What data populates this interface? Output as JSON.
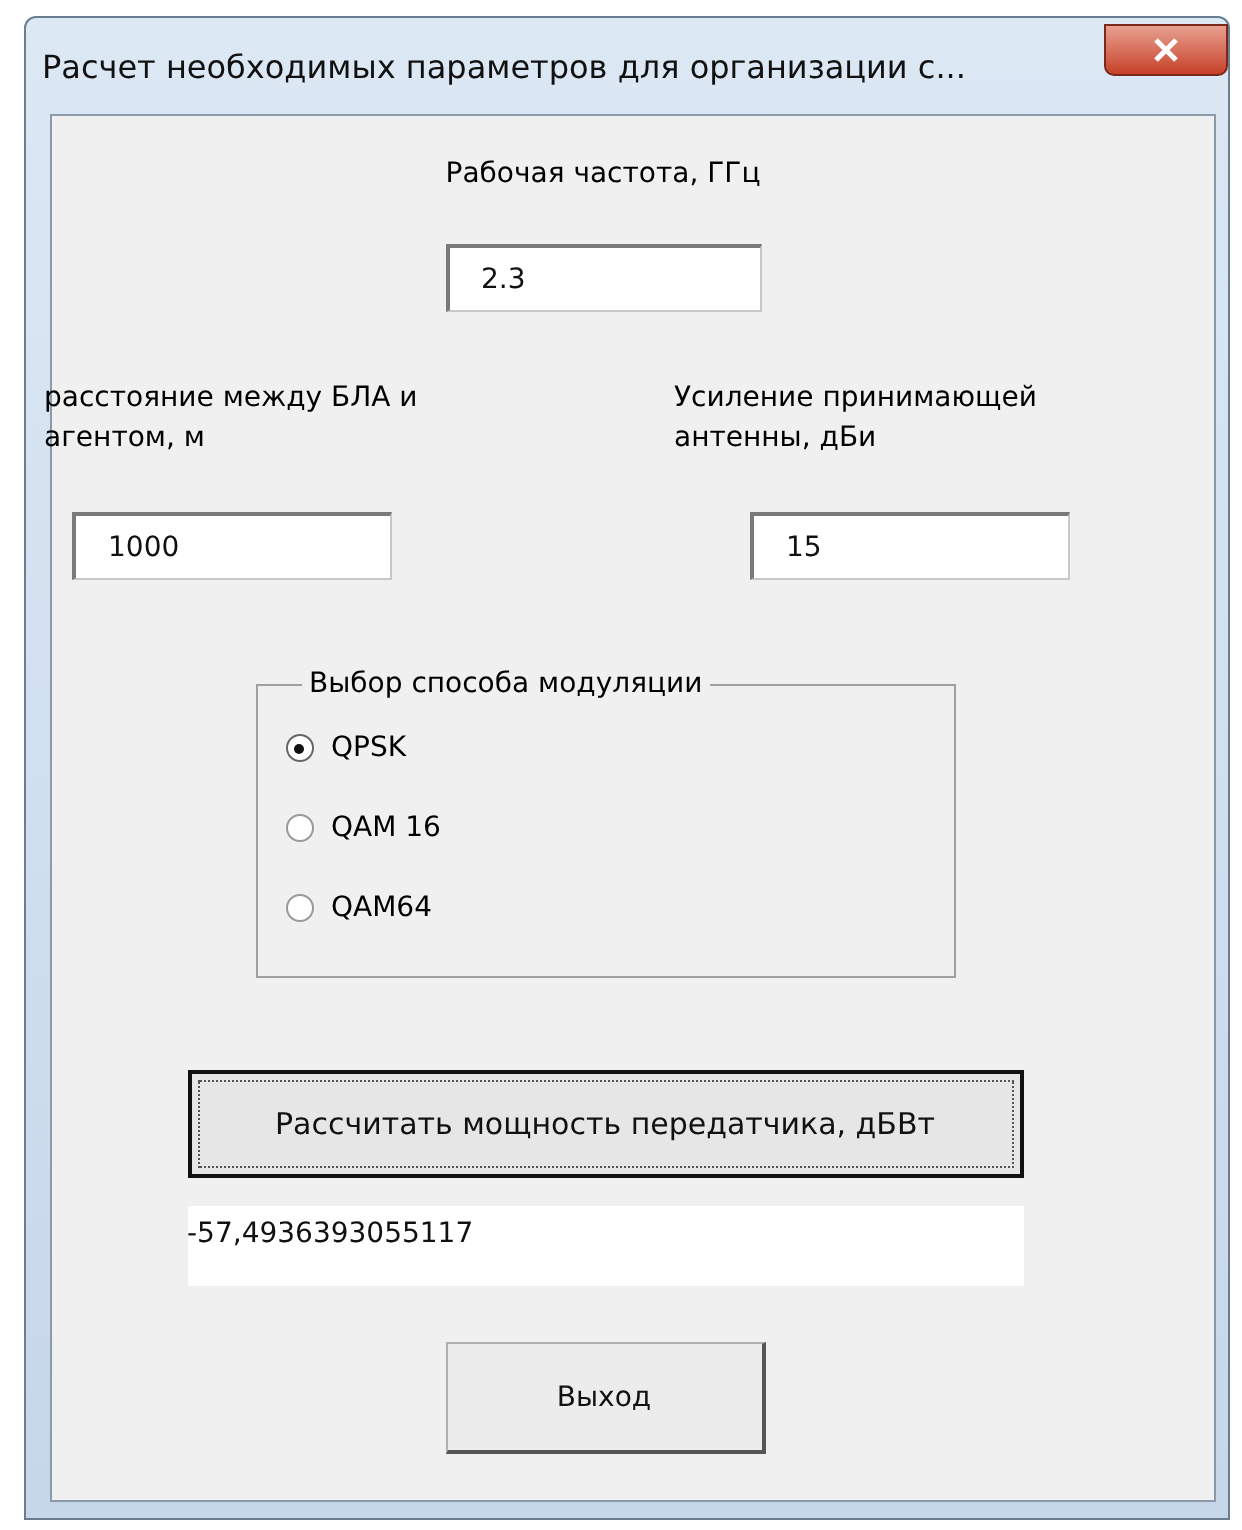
{
  "window": {
    "title": "Расчет необходимых параметров для организации с..."
  },
  "frequency": {
    "label": "Рабочая частота, ГГц",
    "value": "2.3"
  },
  "distance": {
    "label": "расстояние между БЛА и агентом, м",
    "value": "1000"
  },
  "gain": {
    "label": "Усиление принимающей антенны, дБи",
    "value": "15"
  },
  "modulation": {
    "legend": "Выбор способа модуляции",
    "options": [
      {
        "label": "QPSK",
        "selected": true
      },
      {
        "label": "QAM 16",
        "selected": false
      },
      {
        "label": "QAM64",
        "selected": false
      }
    ]
  },
  "compute_button": "Рассчитать мощность передатчика, дБВт",
  "result": {
    "value": "-57,4936393055117"
  },
  "exit_button": "Выход"
}
